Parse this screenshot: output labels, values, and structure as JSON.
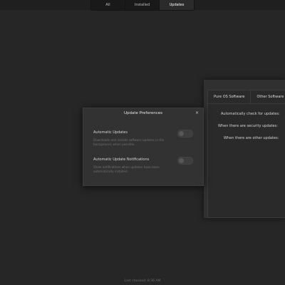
{
  "tabs": [
    {
      "label": "All"
    },
    {
      "label": "Installed"
    },
    {
      "label": "Updates"
    }
  ],
  "software_window": {
    "tabs": [
      "Pure OS Software",
      "Other Software"
    ],
    "rows": [
      "Automatically check for updates:",
      "When there are security updates:",
      "When there are other updates:"
    ]
  },
  "dialog": {
    "title": "Update Preferences",
    "close_glyph": "×",
    "options": [
      {
        "title": "Automatic Updates",
        "description": "Downloads and installs software updates in the background, when possible.",
        "enabled": false
      },
      {
        "title": "Automatic Update Notifications",
        "description": "Show notifications when updates have been automatically installed.",
        "enabled": false
      }
    ]
  },
  "status": "Last checked: 8:36 AM"
}
